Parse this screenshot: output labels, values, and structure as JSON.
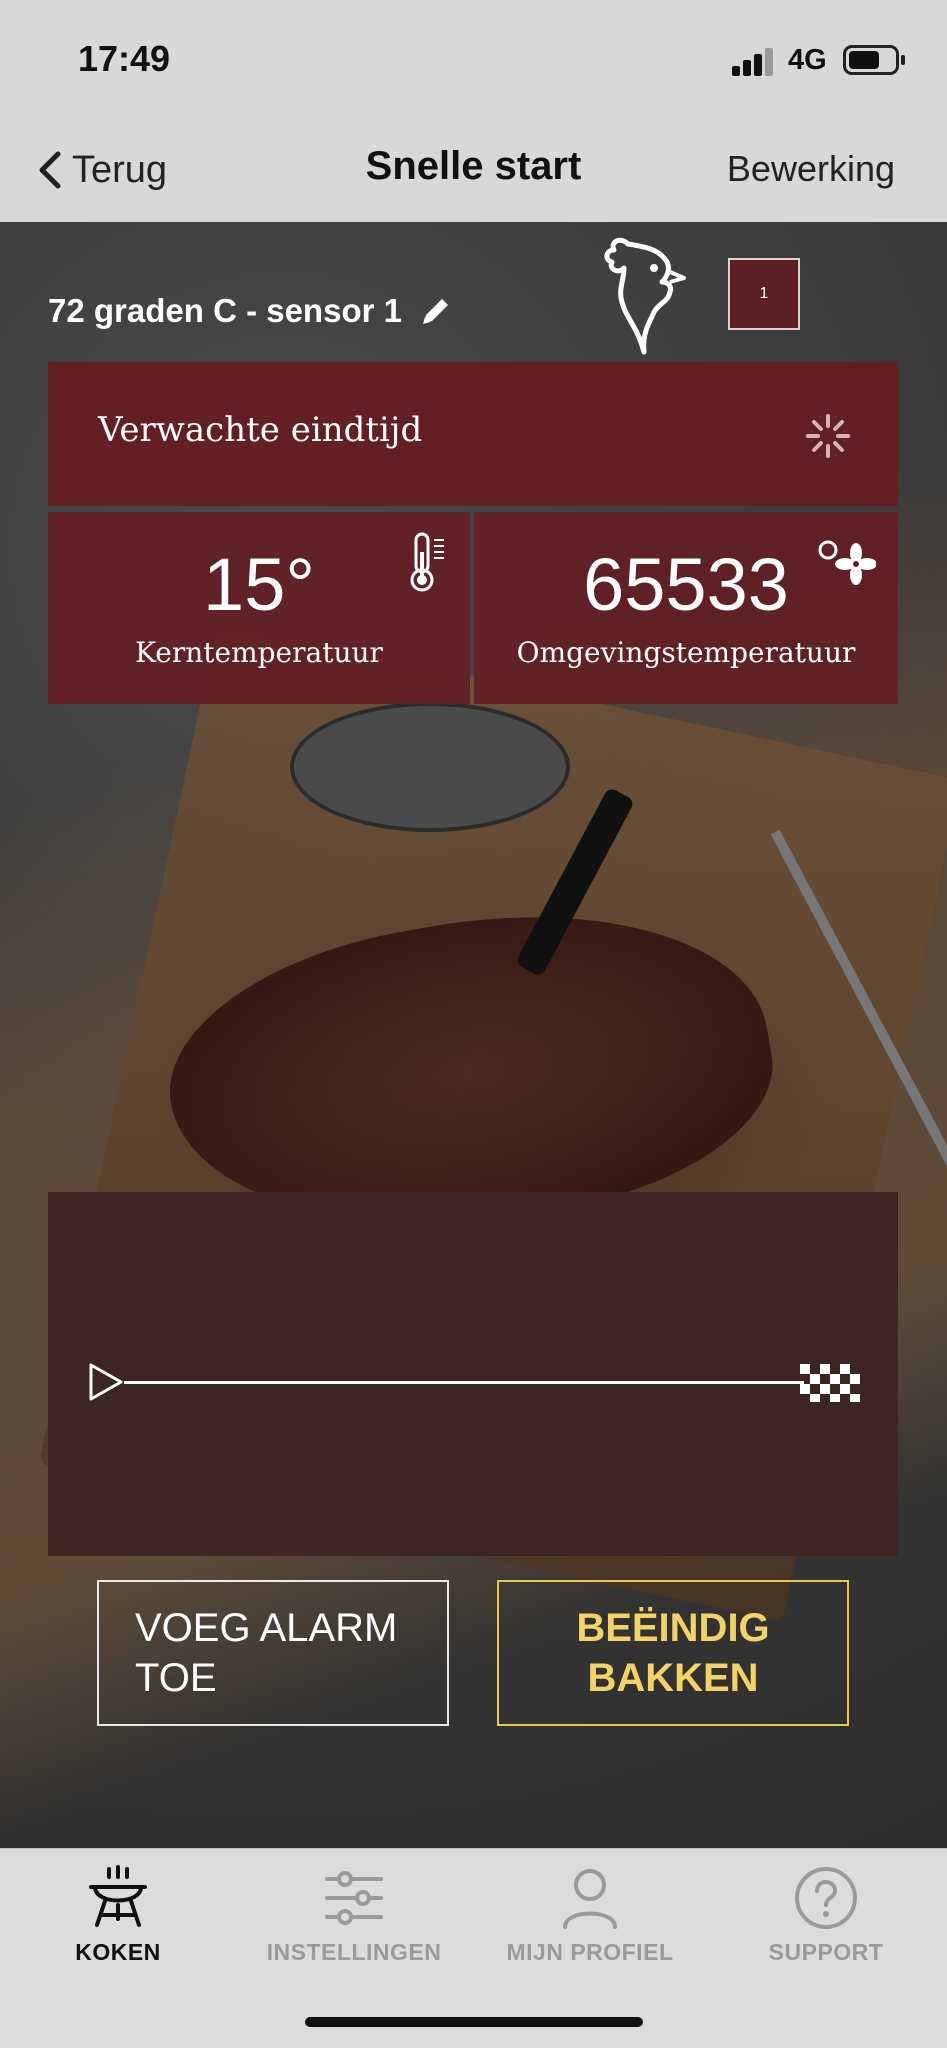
{
  "status_bar": {
    "time": "17:49",
    "network": "4G"
  },
  "nav": {
    "back_label": "Terug",
    "title": "Snelle start",
    "edit_label": "Bewerking"
  },
  "sensor": {
    "label": "72 graden C - sensor 1",
    "count": "1"
  },
  "end_time": {
    "label": "Verwachte eindtijd"
  },
  "temperatures": {
    "core": {
      "value": "15°",
      "label": "Kerntemperatuur"
    },
    "ambient": {
      "value": "65533",
      "label": "Omgevingstemperatuur"
    }
  },
  "actions": {
    "alarm_label": "VOEG ALARM TOE",
    "stop_label": "BEËINDIG BAKKEN"
  },
  "tabs": [
    {
      "label": "KOKEN",
      "icon": "grill-icon",
      "active": true
    },
    {
      "label": "INSTELLINGEN",
      "icon": "sliders-icon",
      "active": false
    },
    {
      "label": "MIJN PROFIEL",
      "icon": "person-icon",
      "active": false
    },
    {
      "label": "SUPPORT",
      "icon": "help-icon",
      "active": false
    }
  ],
  "colors": {
    "panel": "#621f24",
    "timeline": "#3d2523",
    "accent_yellow": "#f3d266"
  }
}
